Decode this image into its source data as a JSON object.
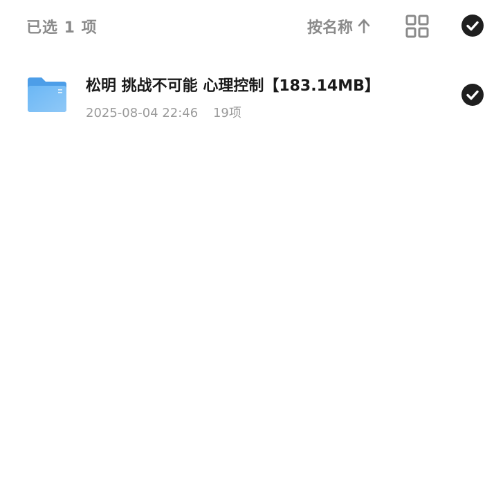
{
  "header": {
    "selected_label": "已选 1 项",
    "sort_label": "按名称",
    "sort_direction_icon": "arrow-up-icon",
    "view_toggle_icon": "grid-view-icon",
    "select_all_icon": "check-circle-icon"
  },
  "files": [
    {
      "name": "松明 挑战不可能 心理控制【183.14MB】",
      "date": "2025-08-04 22:46",
      "count": "19项",
      "icon": "folder-icon",
      "selected": true
    }
  ],
  "colors": {
    "folder": "#5aa9f0",
    "check_bg": "#1f1f1f",
    "muted_text": "#8a8a8a",
    "primary_text": "#1a1a1a"
  }
}
